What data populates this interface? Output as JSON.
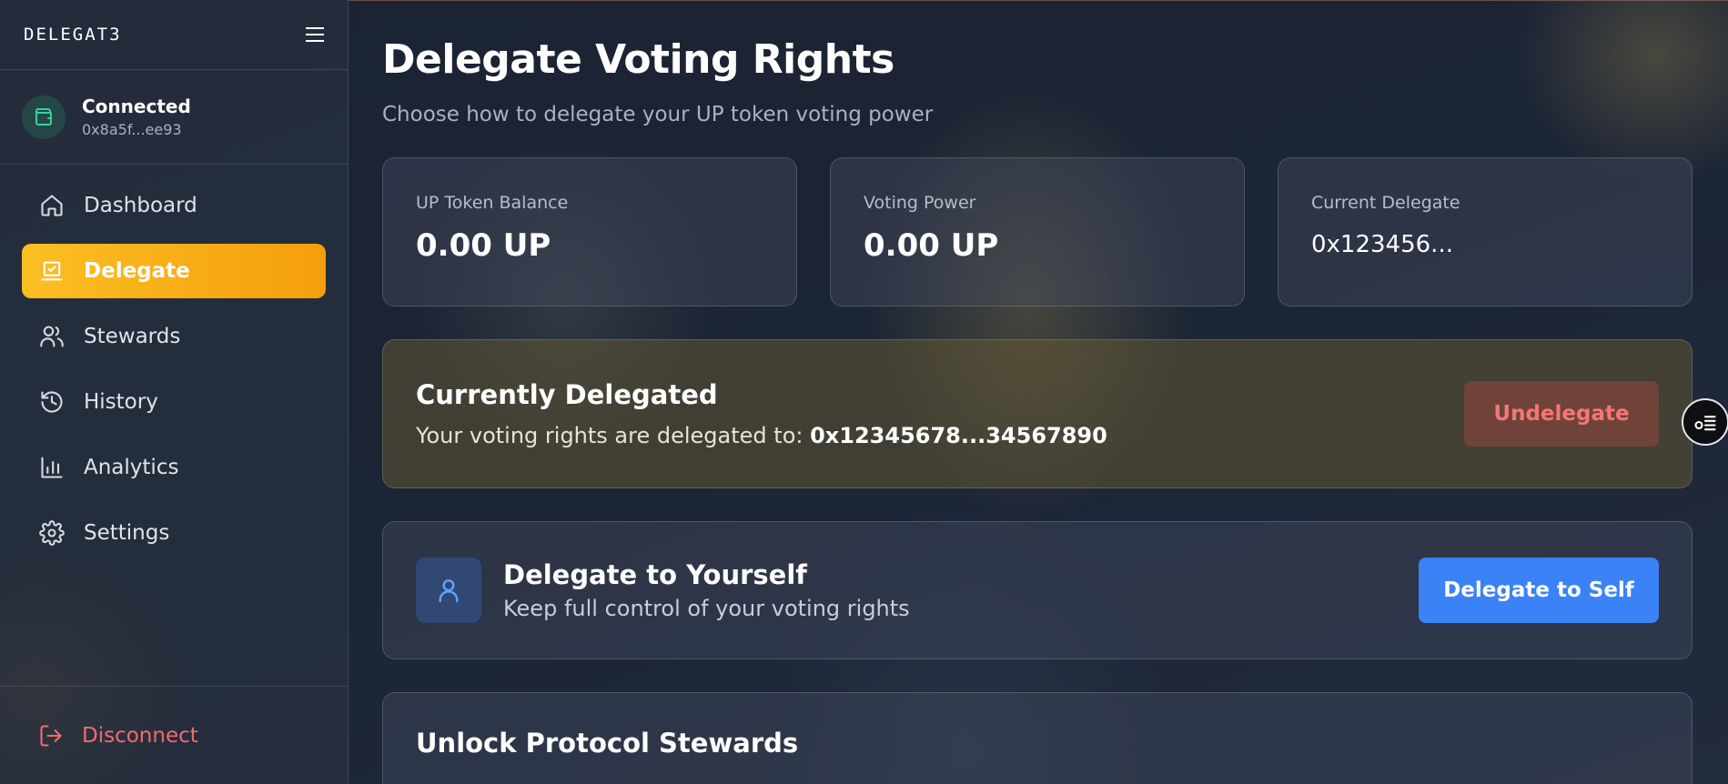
{
  "sidebar": {
    "logo": "DELEGAT3",
    "account": {
      "status": "Connected",
      "address": "0x8a5f...ee93"
    },
    "items": [
      {
        "label": "Dashboard",
        "icon": "home-icon",
        "active": false
      },
      {
        "label": "Delegate",
        "icon": "vote-icon",
        "active": true
      },
      {
        "label": "Stewards",
        "icon": "users-icon",
        "active": false
      },
      {
        "label": "History",
        "icon": "history-icon",
        "active": false
      },
      {
        "label": "Analytics",
        "icon": "bar-chart-icon",
        "active": false
      },
      {
        "label": "Settings",
        "icon": "gear-icon",
        "active": false
      }
    ],
    "disconnect_label": "Disconnect"
  },
  "main": {
    "title": "Delegate Voting Rights",
    "subtitle": "Choose how to delegate your UP token voting power",
    "stats": [
      {
        "label": "UP Token Balance",
        "value": "0.00 UP"
      },
      {
        "label": "Voting Power",
        "value": "0.00 UP"
      },
      {
        "label": "Current Delegate",
        "value": "0x123456..."
      }
    ],
    "delegated": {
      "title": "Currently Delegated",
      "text": "Your voting rights are delegated to: ",
      "address": "0x12345678...34567890",
      "button": "Undelegate"
    },
    "self": {
      "title": "Delegate to Yourself",
      "text": "Keep full control of your voting rights",
      "button": "Delegate to Self"
    },
    "stewards": {
      "title": "Unlock Protocol Stewards"
    }
  },
  "colors": {
    "accent": "#f59e0b",
    "primary_button": "#3b82f6",
    "danger": "#f26b6b"
  }
}
